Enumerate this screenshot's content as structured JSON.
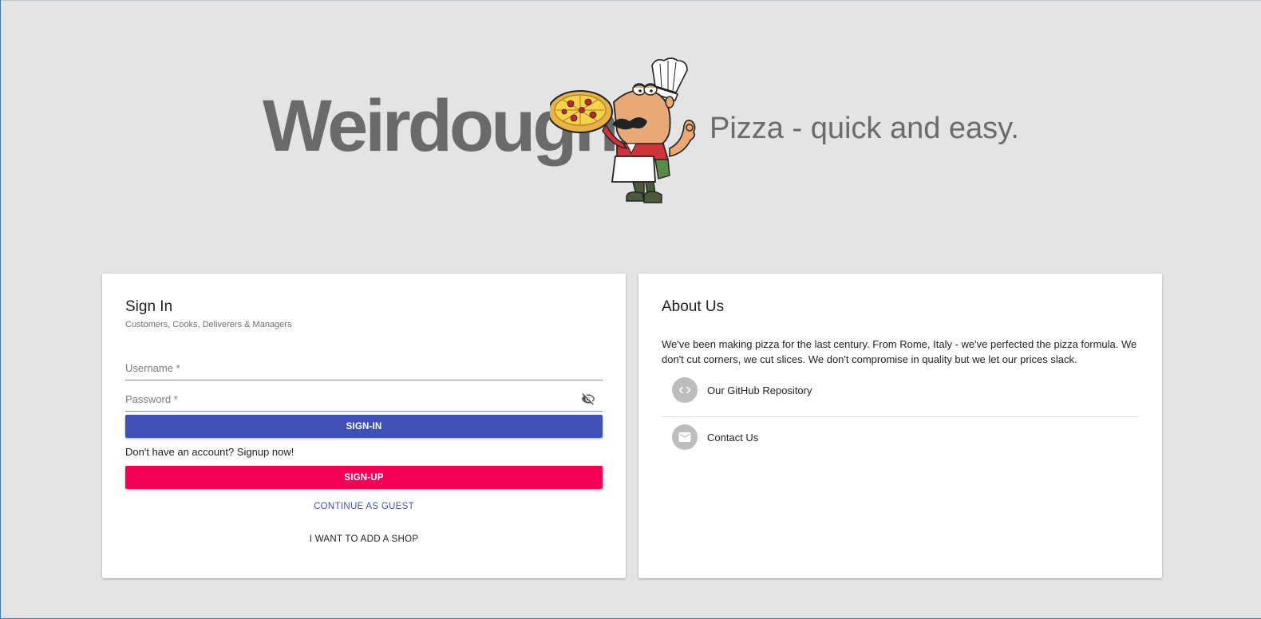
{
  "brand": {
    "name": "Weirdoughs",
    "tagline": "Pizza - quick and easy."
  },
  "signin": {
    "title": "Sign In",
    "subtitle": "Customers, Cooks, Deliverers & Managers",
    "username_placeholder": "Username *",
    "password_placeholder": "Password *",
    "signin_label": "SIGN-IN",
    "signup_prompt": "Don't have an account? Signup now!",
    "signup_label": "SIGN-UP",
    "guest_label": "CONTINUE AS GUEST",
    "shop_label": "I WANT TO ADD A SHOP"
  },
  "about": {
    "title": "About Us",
    "text": "We've been making pizza for the last century. From Rome, Italy - we've perfected the pizza formula. We don't cut corners, we cut slices. We don't compromise in quality but we let our prices slack.",
    "items": [
      {
        "label": "Our GitHub Repository",
        "icon": "code-icon"
      },
      {
        "label": "Contact Us",
        "icon": "mail-icon"
      }
    ]
  },
  "colors": {
    "primary": "#3f51b5",
    "accent": "#f50057",
    "background": "#e4e4e4",
    "brand_text": "#6a6a6a"
  }
}
